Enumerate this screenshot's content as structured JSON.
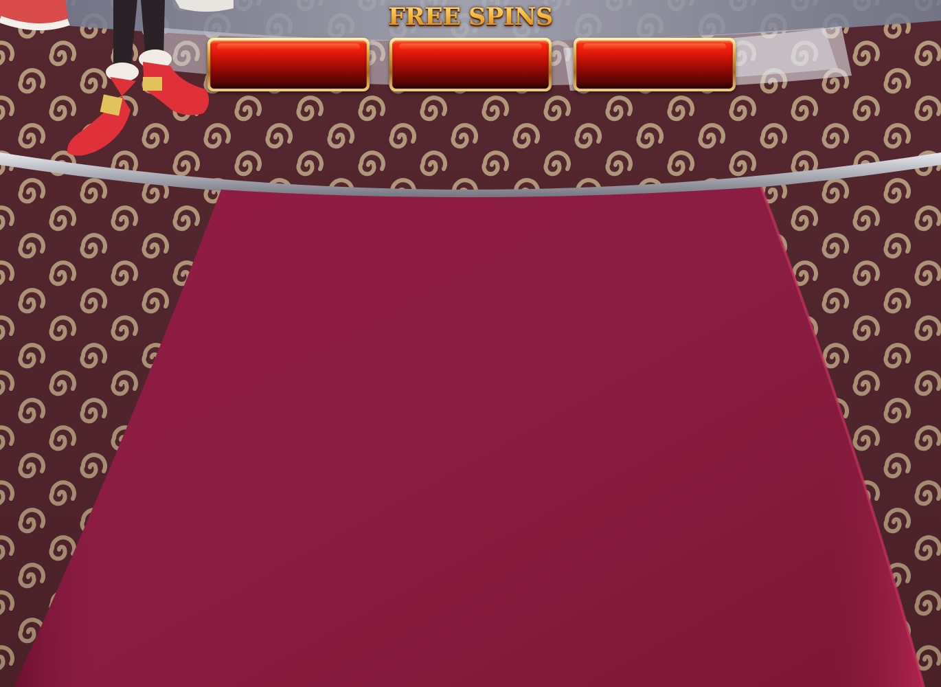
{
  "game": {
    "free_spins_label": "FREE SPINS",
    "spin_slots": [
      {
        "value": ""
      },
      {
        "value": ""
      },
      {
        "value": ""
      }
    ]
  },
  "colors": {
    "carpet_dark": "#5a2730",
    "carpet_light": "#c9ad8a",
    "runner": "#8c1c42",
    "stage_rim": "#b7b7bd",
    "slot_red": "#c8120a",
    "slot_frame_gold": "#e0a23a",
    "title_gold": "#f4b12a"
  },
  "icons": [
    "swirl-carpet-pattern",
    "character-legs",
    "red-shoe-icon"
  ]
}
